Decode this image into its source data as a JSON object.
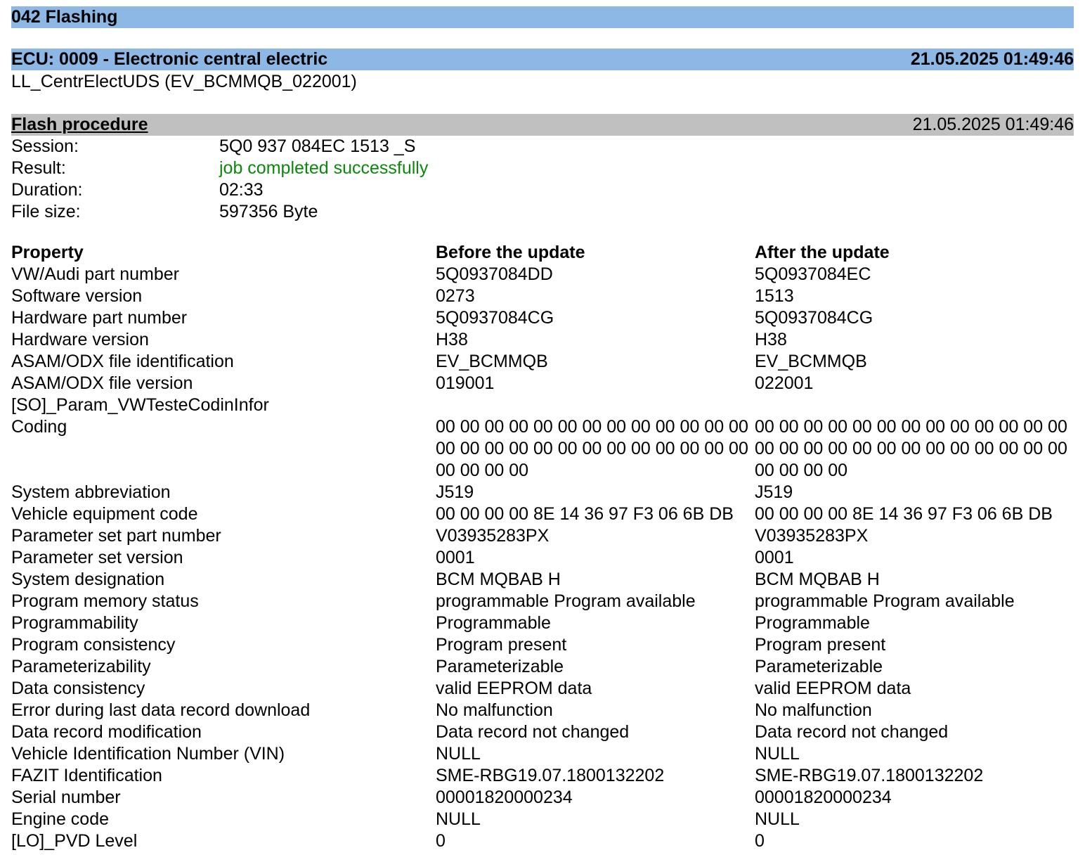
{
  "section_title": "042 Flashing",
  "ecu": {
    "title": "ECU: 0009 - Electronic central electric",
    "timestamp": "21.05.2025 01:49:46",
    "subtitle": "LL_CentrElectUDS (EV_BCMMQB_022001)"
  },
  "flash": {
    "title": "Flash procedure",
    "timestamp": "21.05.2025 01:49:46",
    "fields": [
      {
        "label": "Session:",
        "value": "5Q0 937 084EC 1513 _S"
      },
      {
        "label": "Result:",
        "value": "job completed successfully"
      },
      {
        "label": "Duration:",
        "value": "02:33"
      },
      {
        "label": "File size:",
        "value": "597356 Byte"
      }
    ]
  },
  "colors": {
    "header_bar": "#8db8e6",
    "subheader_bar": "#c0c0c0",
    "success": "#0a8a0a"
  },
  "table": {
    "headers": [
      "Property",
      "Before the update",
      "After the update"
    ],
    "rows": [
      [
        "VW/Audi part number",
        "5Q0937084DD",
        "5Q0937084EC"
      ],
      [
        "Software version",
        "0273",
        "1513"
      ],
      [
        "Hardware part number",
        "5Q0937084CG",
        "5Q0937084CG"
      ],
      [
        "Hardware version",
        "H38",
        "H38"
      ],
      [
        "ASAM/ODX file identification",
        "EV_BCMMQB",
        "EV_BCMMQB"
      ],
      [
        "ASAM/ODX file version",
        "019001",
        "022001"
      ],
      [
        "[SO]_Param_VWTesteCodinInfor",
        "",
        ""
      ],
      [
        "Coding",
        "00 00 00 00 00 00 00 00 00 00 00 00 00 00 00 00 00 00 00 00 00 00 00 00 00 00 00 00 00 00",
        "00 00 00 00 00 00 00 00 00 00 00 00 00 00 00 00 00 00 00 00 00 00 00 00 00 00 00 00 00 00"
      ],
      [
        "System abbreviation",
        "J519",
        "J519"
      ],
      [
        "Vehicle equipment code",
        "00 00 00 00 8E 14 36 97 F3 06 6B DB",
        "00 00 00 00 8E 14 36 97 F3 06 6B DB"
      ],
      [
        "Parameter set part number",
        "V03935283PX",
        "V03935283PX"
      ],
      [
        "Parameter set version",
        "0001",
        "0001"
      ],
      [
        "System designation",
        "BCM MQBAB H",
        "BCM MQBAB H"
      ],
      [
        "Program memory status",
        "programmable Program available",
        "programmable Program available"
      ],
      [
        "Programmability",
        "Programmable",
        "Programmable"
      ],
      [
        "Program consistency",
        "Program present",
        "Program present"
      ],
      [
        "Parameterizability",
        "Parameterizable",
        "Parameterizable"
      ],
      [
        "Data consistency",
        "valid EEPROM data",
        "valid EEPROM data"
      ],
      [
        "Error during last data record download",
        "No malfunction",
        "No malfunction"
      ],
      [
        "Data record modification",
        "Data record not changed",
        "Data record not changed"
      ],
      [
        "Vehicle Identification Number (VIN)",
        "NULL",
        "NULL"
      ],
      [
        "FAZIT Identification",
        "SME-RBG19.07.1800132202",
        "SME-RBG19.07.1800132202"
      ],
      [
        "Serial number",
        "00001820000234",
        "00001820000234"
      ],
      [
        "Engine code",
        "NULL",
        "NULL"
      ],
      [
        "[LO]_PVD Level",
        "0",
        "0"
      ]
    ]
  }
}
